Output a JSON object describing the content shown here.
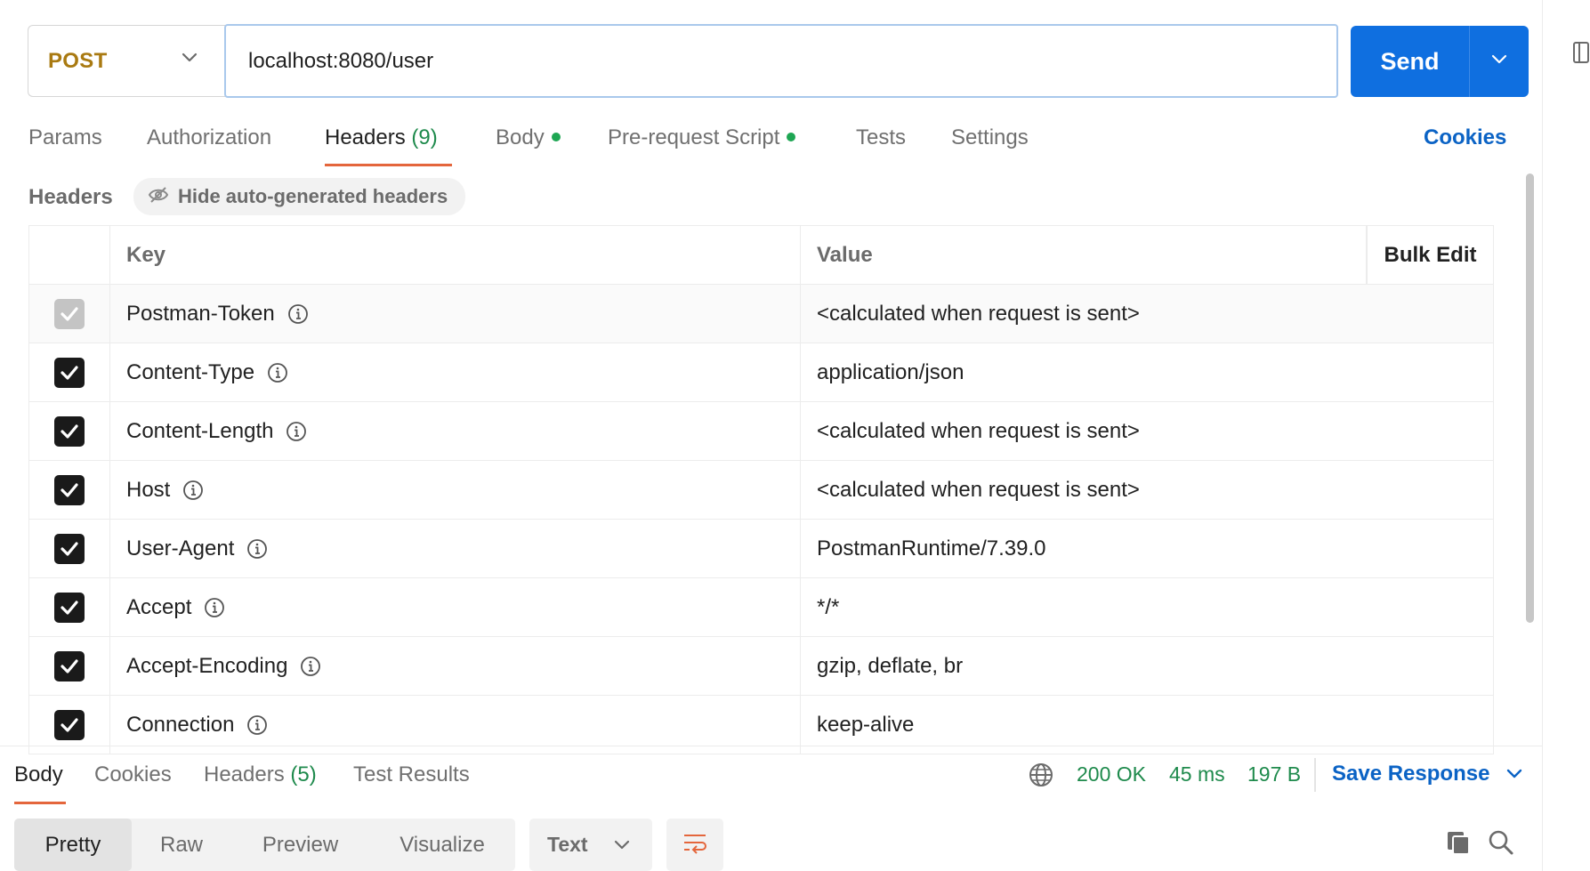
{
  "request": {
    "method": "POST",
    "url": "localhost:8080/user",
    "send_label": "Send"
  },
  "tabs": [
    {
      "label": "Params"
    },
    {
      "label": "Authorization"
    },
    {
      "label": "Headers",
      "count": "(9)",
      "active": true
    },
    {
      "label": "Body",
      "dot": true
    },
    {
      "label": "Pre-request Script",
      "dot": true
    },
    {
      "label": "Tests"
    },
    {
      "label": "Settings"
    }
  ],
  "cookies_label": "Cookies",
  "headers_section": {
    "title": "Headers",
    "hide_label": "Hide auto-generated headers"
  },
  "table": {
    "key_header": "Key",
    "value_header": "Value",
    "bulk_edit": "Bulk Edit",
    "rows": [
      {
        "key": "Postman-Token",
        "value": "<calculated when request is sent>",
        "checked": true,
        "disabled": true
      },
      {
        "key": "Content-Type",
        "value": "application/json",
        "checked": true
      },
      {
        "key": "Content-Length",
        "value": "<calculated when request is sent>",
        "checked": true
      },
      {
        "key": "Host",
        "value": "<calculated when request is sent>",
        "checked": true
      },
      {
        "key": "User-Agent",
        "value": "PostmanRuntime/7.39.0",
        "checked": true
      },
      {
        "key": "Accept",
        "value": "*/*",
        "checked": true
      },
      {
        "key": "Accept-Encoding",
        "value": "gzip, deflate, br",
        "checked": true
      },
      {
        "key": "Connection",
        "value": "keep-alive",
        "checked": true
      }
    ]
  },
  "response": {
    "tabs": [
      {
        "label": "Body",
        "active": true
      },
      {
        "label": "Cookies"
      },
      {
        "label": "Headers",
        "count": "(5)"
      },
      {
        "label": "Test Results"
      }
    ],
    "status": "200 OK",
    "time": "45 ms",
    "size": "197 B",
    "save_label": "Save Response",
    "views": [
      "Pretty",
      "Raw",
      "Preview",
      "Visualize"
    ],
    "format": "Text"
  },
  "colors": {
    "accent": "#0f6fe0",
    "method": "#a97a12",
    "success": "#1e8a4c",
    "active_tab": "#e4663c"
  }
}
